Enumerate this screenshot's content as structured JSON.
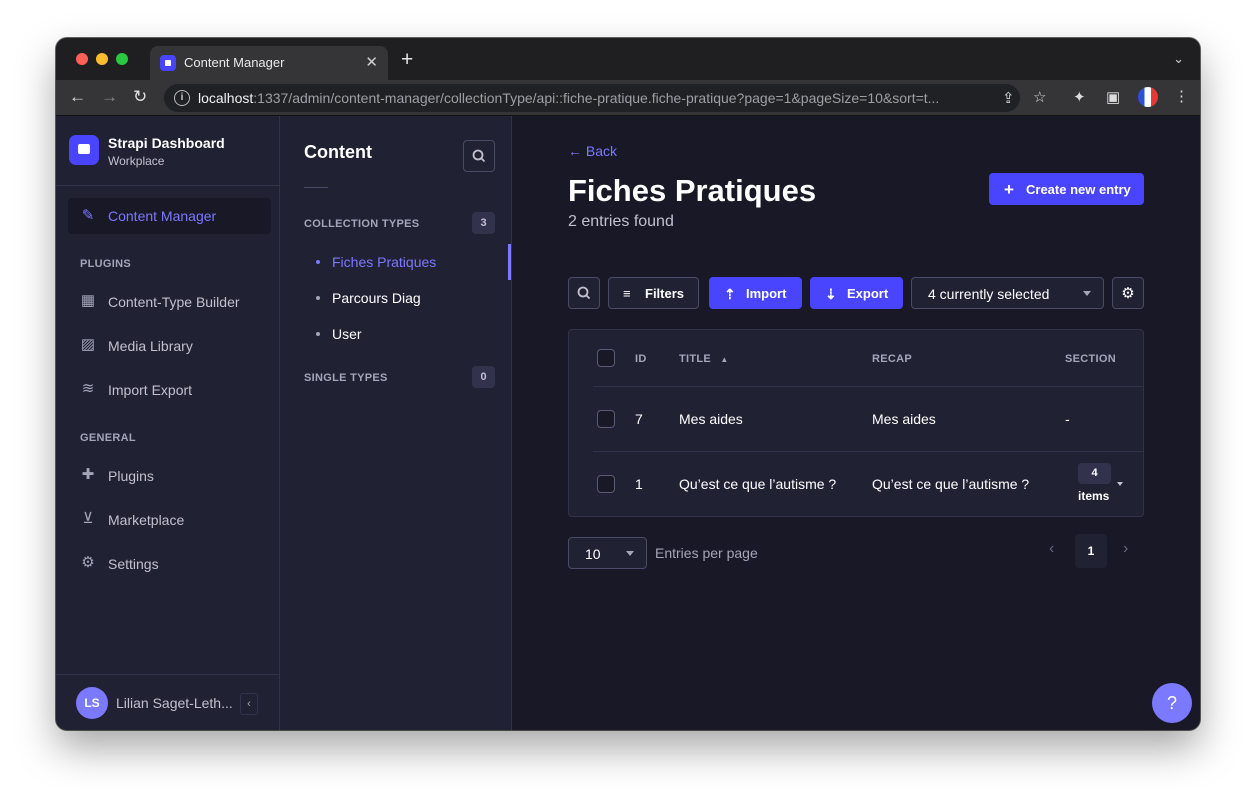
{
  "browser": {
    "tab_title": "Content Manager",
    "url_host": "localhost",
    "url_rest": ":1337/admin/content-manager/collectionType/api::fiche-pratique.fiche-pratique?page=1&pageSize=10&sort=t..."
  },
  "sidebar": {
    "brand_title": "Strapi Dashboard",
    "brand_subtitle": "Workplace",
    "active_item": "Content Manager",
    "plugins_header": "PLUGINS",
    "plugins": [
      "Content-Type Builder",
      "Media Library",
      "Import Export"
    ],
    "general_header": "GENERAL",
    "general": [
      "Plugins",
      "Marketplace",
      "Settings"
    ],
    "user_initials": "LS",
    "user_name": "Lilian Saget-Leth..."
  },
  "subnav": {
    "title": "Content",
    "collection_header": "COLLECTION TYPES",
    "collection_count": "3",
    "collections": [
      "Fiches Pratiques",
      "Parcours Diag",
      "User"
    ],
    "single_header": "SINGLE TYPES",
    "single_count": "0"
  },
  "main": {
    "back_label": "Back",
    "title": "Fiches Pratiques",
    "subtitle": "2 entries found",
    "create_label": "Create new entry",
    "filters_label": "Filters",
    "import_label": "Import",
    "export_label": "Export",
    "selected_label": "4 currently selected",
    "columns": [
      "ID",
      "TITLE",
      "RECAP",
      "SECTION"
    ],
    "rows": [
      {
        "id": "7",
        "title": "Mes aides",
        "recap": "Mes aides",
        "section": "-"
      },
      {
        "id": "1",
        "title": "Qu’est ce que l’autisme ?",
        "recap": "Qu’est ce que l’autisme ?",
        "section_count": "4",
        "section_label": "items"
      }
    ],
    "page_size": "10",
    "page_size_label": "Entries per page",
    "current_page": "1"
  },
  "help_label": "?",
  "colors": {
    "accent": "#4945ff",
    "accent_light": "#7b79ff",
    "bg": "#181826",
    "panel": "#212134"
  }
}
